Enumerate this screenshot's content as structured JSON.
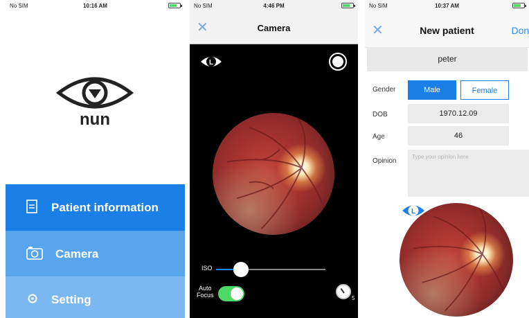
{
  "screen1": {
    "status": {
      "carrier": "No SIM",
      "time": "10:16 AM"
    },
    "logo_text": "nun",
    "menu": [
      {
        "label": "Patient information",
        "icon": "document-icon",
        "color": "#1a7fe6"
      },
      {
        "label": "Camera",
        "icon": "camera-icon",
        "color": "#58a5ee"
      },
      {
        "label": "Setting",
        "icon": "gear-icon",
        "color": "#7bb8f2"
      }
    ]
  },
  "screen2": {
    "status": {
      "carrier": "No SIM",
      "time": "4:46 PM"
    },
    "title": "Camera",
    "eye_badge": "L",
    "iso_label": "ISO",
    "iso_level": 0.23,
    "autofocus_label_line1": "Auto",
    "autofocus_label_line2": "Focus",
    "autofocus_on": true,
    "timer_sub": "5",
    "accent": "#1a8cff"
  },
  "screen3": {
    "status": {
      "carrier": "No SIM",
      "time": "10:37 AM"
    },
    "title": "New patient",
    "done_label": "Done",
    "name": "peter",
    "gender_label": "Gender",
    "gender_options": [
      "Male",
      "Female"
    ],
    "gender_selected": "Male",
    "dob_label": "DOB",
    "dob_value": "1970.12.09",
    "age_label": "Age",
    "age_value": "46",
    "opinion_label": "Opinion",
    "opinion_placeholder": "Type your opinion here",
    "eye_badge": "L"
  }
}
